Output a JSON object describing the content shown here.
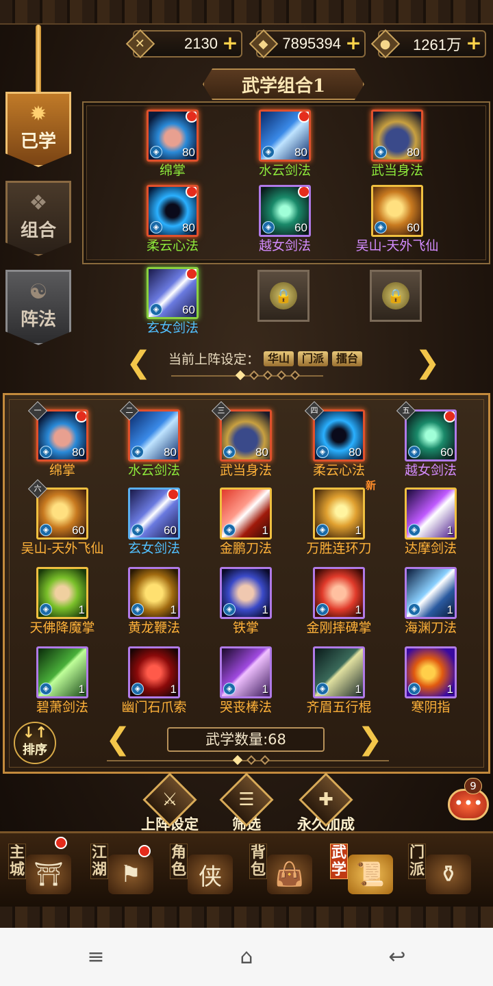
{
  "currencies": [
    {
      "icon": "sword-token-icon",
      "value": "2130"
    },
    {
      "icon": "diamond-coin-icon",
      "value": "7895394"
    },
    {
      "icon": "silver-coin-icon",
      "value": "1261万"
    }
  ],
  "side_tabs": [
    {
      "label": "已学",
      "icon": "flame-book-icon",
      "state": "active"
    },
    {
      "label": "组合",
      "icon": "scroll-icon",
      "state": "normal"
    },
    {
      "label": "阵法",
      "icon": "yinyang-icon",
      "state": "dim"
    }
  ],
  "combo": {
    "title": "武学组合1",
    "equipped": [
      {
        "name": "绵掌",
        "level": "80",
        "color": "green",
        "quality": "red",
        "dot": true,
        "art": "palm"
      },
      {
        "name": "水云剑法",
        "level": "80",
        "color": "green",
        "quality": "red",
        "dot": true,
        "art": "blade"
      },
      {
        "name": "武当身法",
        "level": "80",
        "color": "green",
        "quality": "red",
        "dot": false,
        "art": "boot"
      },
      {
        "name": "柔云心法",
        "level": "80",
        "color": "green",
        "quality": "red",
        "dot": true,
        "art": "meditate"
      },
      {
        "name": "越女剑法",
        "level": "60",
        "color": "purple",
        "quality": "purple",
        "dot": true,
        "art": "sword"
      },
      {
        "name": "吴山-天外飞仙",
        "level": "60",
        "color": "purple",
        "quality": "gold",
        "dot": false,
        "art": "dancer"
      },
      {
        "name": "玄女剑法",
        "level": "60",
        "color": "blue",
        "quality": "green",
        "dot": true,
        "art": "slash"
      }
    ],
    "locked_slots": 2,
    "formation_label": "当前上阵设定：",
    "formation_tags": [
      "华山",
      "门派",
      "擂台"
    ]
  },
  "library": {
    "skills": [
      {
        "name": "绵掌",
        "level": "80",
        "color": "orange",
        "quality": "red",
        "corner": "一",
        "art": "palm",
        "dot": true
      },
      {
        "name": "水云剑法",
        "level": "80",
        "color": "green",
        "quality": "red",
        "corner": "二",
        "art": "blade",
        "dot": false
      },
      {
        "name": "武当身法",
        "level": "80",
        "color": "orange",
        "quality": "red",
        "corner": "三",
        "art": "boot",
        "dot": false
      },
      {
        "name": "柔云心法",
        "level": "80",
        "color": "orange",
        "quality": "red",
        "corner": "四",
        "art": "meditate",
        "dot": false
      },
      {
        "name": "越女剑法",
        "level": "60",
        "color": "purple",
        "quality": "purple",
        "corner": "五",
        "art": "sword",
        "dot": true
      },
      {
        "name": "吴山-天外飞仙",
        "level": "60",
        "color": "orange",
        "quality": "gold",
        "corner": "六",
        "art": "dancer",
        "dot": false
      },
      {
        "name": "玄女剑法",
        "level": "60",
        "color": "blue",
        "quality": "blue",
        "corner": "",
        "art": "slash",
        "dot": true
      },
      {
        "name": "金鹏刀法",
        "level": "1",
        "color": "orange",
        "quality": "gold",
        "corner": "",
        "art": "redblade",
        "dot": false
      },
      {
        "name": "万胜连环刀",
        "level": "1",
        "color": "orange",
        "quality": "gold",
        "corner": "",
        "art": "goldfire",
        "dot": false,
        "new": "新"
      },
      {
        "name": "达摩剑法",
        "level": "1",
        "color": "orange",
        "quality": "gold",
        "corner": "",
        "art": "violet",
        "dot": false
      },
      {
        "name": "天佛降魔掌",
        "level": "1",
        "color": "orange",
        "quality": "gold",
        "corner": "",
        "art": "greenhand",
        "dot": false
      },
      {
        "name": "黄龙鞭法",
        "level": "1",
        "color": "orange",
        "quality": "purple",
        "corner": "",
        "art": "whip",
        "dot": false
      },
      {
        "name": "铁掌",
        "level": "1",
        "color": "orange",
        "quality": "purple",
        "corner": "",
        "art": "ironhand",
        "dot": false
      },
      {
        "name": "金刚摔碑掌",
        "level": "1",
        "color": "orange",
        "quality": "purple",
        "corner": "",
        "art": "redhand",
        "dot": false
      },
      {
        "name": "海渊刀法",
        "level": "1",
        "color": "orange",
        "quality": "purple",
        "corner": "",
        "art": "blueblade",
        "dot": false
      },
      {
        "name": "碧萧剑法",
        "level": "1",
        "color": "orange",
        "quality": "purple",
        "corner": "",
        "art": "flute",
        "dot": false
      },
      {
        "name": "幽门石爪索",
        "level": "1",
        "color": "orange",
        "quality": "purple",
        "corner": "",
        "art": "claw",
        "dot": false
      },
      {
        "name": "哭丧棒法",
        "level": "1",
        "color": "orange",
        "quality": "purple",
        "corner": "",
        "art": "staff",
        "dot": false
      },
      {
        "name": "齐眉五行棍",
        "level": "1",
        "color": "orange",
        "quality": "purple",
        "corner": "",
        "art": "rods",
        "dot": false
      },
      {
        "name": "寒阴指",
        "level": "1",
        "color": "orange",
        "quality": "purple",
        "corner": "",
        "art": "fire",
        "dot": false
      }
    ],
    "count_label": "武学数量:68",
    "sort_label_top": "↓↑",
    "sort_label": "排序"
  },
  "actions": [
    {
      "label": "上阵设定",
      "icon": "swords-icon",
      "glyph": "⚔"
    },
    {
      "label": "筛选",
      "icon": "filter-icon",
      "glyph": "☰"
    },
    {
      "label": "永久加成",
      "icon": "scroll-plus-icon",
      "glyph": "✚"
    }
  ],
  "chat_badge": "9",
  "nav": [
    {
      "label": "主城",
      "icon": "palace-icon",
      "glyph": "⛩",
      "dot": true,
      "active": false
    },
    {
      "label": "江湖",
      "icon": "flag-icon",
      "glyph": "⚑",
      "dot": true,
      "active": false
    },
    {
      "label": "角色",
      "icon": "character-scroll-icon",
      "glyph": "侠",
      "dot": false,
      "active": false
    },
    {
      "label": "背包",
      "icon": "bag-icon",
      "glyph": "👜",
      "dot": false,
      "active": false
    },
    {
      "label": "武学",
      "icon": "martial-scroll-icon",
      "glyph": "📜",
      "dot": false,
      "active": true
    },
    {
      "label": "门派",
      "icon": "cauldron-icon",
      "glyph": "⚱",
      "dot": false,
      "active": false
    }
  ],
  "system_bar": {
    "menu": "menu-icon",
    "home": "home-icon",
    "back": "back-icon"
  }
}
